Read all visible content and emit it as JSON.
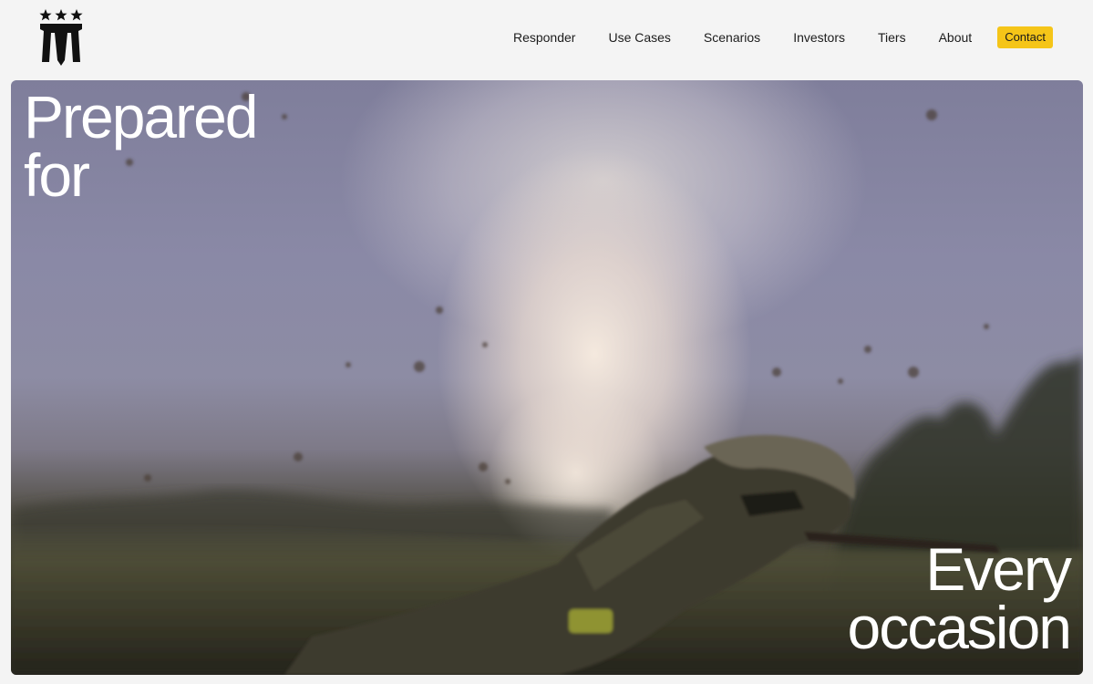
{
  "nav": {
    "items": [
      {
        "id": "responder",
        "label": "Responder"
      },
      {
        "id": "use-cases",
        "label": "Use Cases"
      },
      {
        "id": "scenarios",
        "label": "Scenarios"
      },
      {
        "id": "investors",
        "label": "Investors"
      },
      {
        "id": "tiers",
        "label": "Tiers"
      },
      {
        "id": "about",
        "label": "About"
      }
    ],
    "contact_label": "Contact"
  },
  "hero": {
    "headline_top": [
      "Prepared",
      "for"
    ],
    "headline_bottom": [
      "Every",
      "occasion"
    ]
  },
  "colors": {
    "accent": "#f5c518",
    "header_bg": "#f4f4f4",
    "text": "#1c1c1c"
  },
  "icons": {
    "logo": "three-stars-shield-logo"
  }
}
